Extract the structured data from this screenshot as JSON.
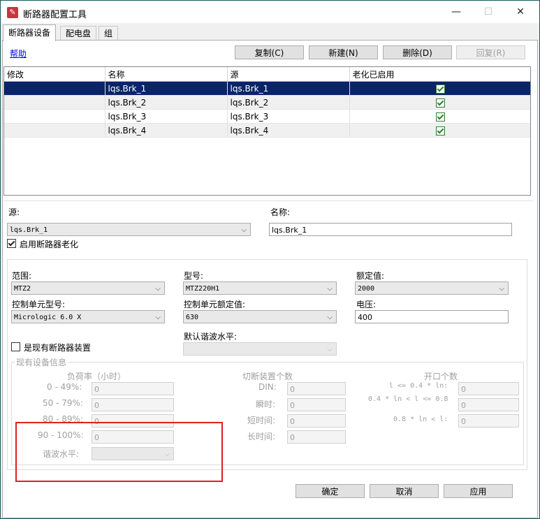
{
  "window": {
    "title": "断路器配置工具",
    "minimize": "—",
    "maximize": "☐",
    "close": "✕"
  },
  "tabs": [
    "断路器设备",
    "配电盘",
    "组"
  ],
  "help_link": "帮助",
  "toolbar": {
    "copy": "复制(C)",
    "new": "新建(N)",
    "delete": "删除(D)",
    "restore": "回复(R)"
  },
  "grid": {
    "columns": [
      "修改",
      "名称",
      "源",
      "老化已启用"
    ],
    "rows": [
      {
        "modified": "",
        "name": "lqs.Brk_1",
        "source": "lqs.Brk_1",
        "aging": true
      },
      {
        "modified": "",
        "name": "lqs.Brk_2",
        "source": "lqs.Brk_2",
        "aging": true
      },
      {
        "modified": "",
        "name": "lqs.Brk_3",
        "source": "lqs.Brk_3",
        "aging": true
      },
      {
        "modified": "",
        "name": "lqs.Brk_4",
        "source": "lqs.Brk_4",
        "aging": true
      }
    ]
  },
  "details": {
    "source_label": "源:",
    "source_value": "lqs.Brk_1",
    "name_label": "名称:",
    "name_value": "lqs.Brk_1",
    "enable_aging_label": "启用断路器老化",
    "enable_aging": true
  },
  "config": {
    "range_label": "范围:",
    "range_value": "MTZ2",
    "model_label": "型号:",
    "model_value": "MTZ220H1",
    "rated_label": "额定值:",
    "rated_value": "2000",
    "ctrl_model_label": "控制单元型号:",
    "ctrl_model_value": "Micrologic 6.0 X",
    "ctrl_rated_label": "控制单元额定值:",
    "ctrl_rated_value": "630",
    "voltage_label": "电压:",
    "voltage_value": "400",
    "harmonic_default_label": "默认谐波水平:",
    "harmonic_default_value": "",
    "existing_label": "是现有断路器装置",
    "existing": false
  },
  "existing_info": {
    "group_label": "现有设备信息",
    "load_header": "负荷率（小时）",
    "load_rows": [
      {
        "label": "0 - 49%:",
        "value": "0"
      },
      {
        "label": "50 - 79%:",
        "value": "0"
      },
      {
        "label": "80 - 89%:",
        "value": "0"
      },
      {
        "label": "90 - 100%:",
        "value": "0"
      }
    ],
    "harmonic_label": "谐波水平:",
    "trip_header": "切断装置个数",
    "trip_rows": [
      {
        "label": "DIN:",
        "value": "0"
      },
      {
        "label": "瞬时:",
        "value": "0"
      },
      {
        "label": "短时间:",
        "value": "0"
      },
      {
        "label": "长时间:",
        "value": "0"
      }
    ],
    "open_header": "开口个数",
    "open_rows": [
      {
        "label": "l <= 0.4 * ln:",
        "value": "0"
      },
      {
        "label": "0.4 * ln < l <= 0.8",
        "value": "0"
      },
      {
        "label": "0.8 * ln < l:",
        "value": "0"
      }
    ]
  },
  "footer": {
    "ok": "确定",
    "cancel": "取消",
    "apply": "应用"
  },
  "colors": {
    "selected_row": "#0a246a",
    "highlight_box": "#e02020"
  }
}
